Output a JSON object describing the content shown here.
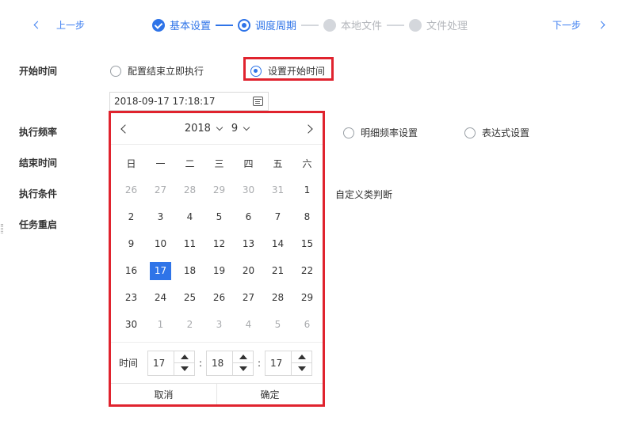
{
  "header": {
    "prev_label": "上一步",
    "next_label": "下一步",
    "steps": [
      {
        "label": "基本设置",
        "state": "done"
      },
      {
        "label": "调度周期",
        "state": "current"
      },
      {
        "label": "本地文件",
        "state": "todo"
      },
      {
        "label": "文件处理",
        "state": "todo"
      }
    ]
  },
  "form": {
    "start_time_label": "开始时间",
    "opt_immediate": "配置结束立即执行",
    "opt_set_start": "设置开始时间",
    "date_value": "2018-09-17 17:18:17",
    "frequency_label": "执行频率",
    "opt_detail_freq": "明细频率设置",
    "opt_expression": "表达式设置",
    "end_time_label": "结束时间",
    "condition_label": "执行条件",
    "opt_custom": "自定义类判断",
    "restart_label": "任务重启"
  },
  "calendar": {
    "year": "2018",
    "month": "9",
    "weekdays": [
      "日",
      "一",
      "二",
      "三",
      "四",
      "五",
      "六"
    ],
    "days": [
      {
        "d": "26",
        "m": true
      },
      {
        "d": "27",
        "m": true
      },
      {
        "d": "28",
        "m": true
      },
      {
        "d": "29",
        "m": true
      },
      {
        "d": "30",
        "m": true
      },
      {
        "d": "31",
        "m": true
      },
      {
        "d": "1",
        "m": false
      },
      {
        "d": "2",
        "m": false
      },
      {
        "d": "3",
        "m": false
      },
      {
        "d": "4",
        "m": false
      },
      {
        "d": "5",
        "m": false
      },
      {
        "d": "6",
        "m": false
      },
      {
        "d": "7",
        "m": false
      },
      {
        "d": "8",
        "m": false
      },
      {
        "d": "9",
        "m": false
      },
      {
        "d": "10",
        "m": false
      },
      {
        "d": "11",
        "m": false
      },
      {
        "d": "12",
        "m": false
      },
      {
        "d": "13",
        "m": false
      },
      {
        "d": "14",
        "m": false
      },
      {
        "d": "15",
        "m": false
      },
      {
        "d": "16",
        "m": false
      },
      {
        "d": "17",
        "m": false,
        "sel": true
      },
      {
        "d": "18",
        "m": false
      },
      {
        "d": "19",
        "m": false
      },
      {
        "d": "20",
        "m": false
      },
      {
        "d": "21",
        "m": false
      },
      {
        "d": "22",
        "m": false
      },
      {
        "d": "23",
        "m": false
      },
      {
        "d": "24",
        "m": false
      },
      {
        "d": "25",
        "m": false
      },
      {
        "d": "26",
        "m": false
      },
      {
        "d": "27",
        "m": false
      },
      {
        "d": "28",
        "m": false
      },
      {
        "d": "29",
        "m": false
      },
      {
        "d": "30",
        "m": false
      },
      {
        "d": "1",
        "m": true
      },
      {
        "d": "2",
        "m": true
      },
      {
        "d": "3",
        "m": true
      },
      {
        "d": "4",
        "m": true
      },
      {
        "d": "5",
        "m": true
      },
      {
        "d": "6",
        "m": true
      }
    ],
    "time_label": "时间",
    "hour": "17",
    "minute": "18",
    "second": "17",
    "colon": ":",
    "cancel_label": "取消",
    "confirm_label": "确定"
  },
  "colors": {
    "accent": "#2f74e8",
    "highlight": "#e0232e"
  }
}
